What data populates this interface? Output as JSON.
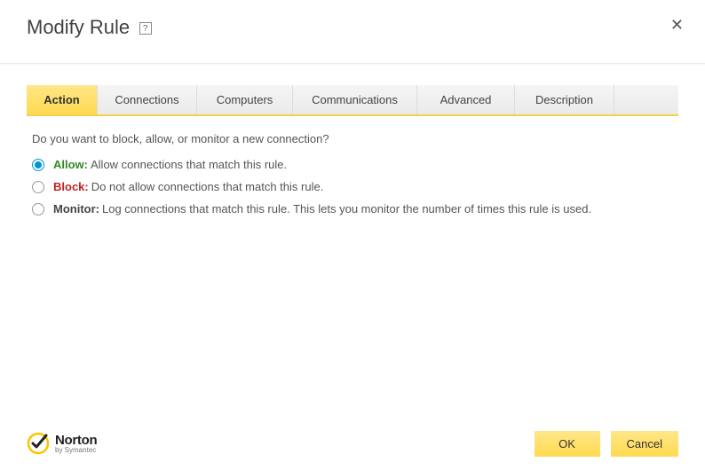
{
  "header": {
    "title": "Modify Rule",
    "help_glyph": "?",
    "close_glyph": "✕"
  },
  "tabs": [
    {
      "label": "Action",
      "active": true
    },
    {
      "label": "Connections",
      "active": false
    },
    {
      "label": "Computers",
      "active": false
    },
    {
      "label": "Communications",
      "active": false
    },
    {
      "label": "Advanced",
      "active": false
    },
    {
      "label": "Description",
      "active": false
    }
  ],
  "panel": {
    "prompt": "Do you want to block, allow, or monitor a new connection?",
    "options": [
      {
        "key": "allow",
        "label": "Allow:",
        "desc": "Allow connections that match this rule.",
        "selected": true
      },
      {
        "key": "block",
        "label": "Block:",
        "desc": "Do not allow connections that match this rule.",
        "selected": false
      },
      {
        "key": "monitor",
        "label": "Monitor:",
        "desc": "Log connections that match this rule. This lets you monitor the number of times this rule is used.",
        "selected": false
      }
    ]
  },
  "brand": {
    "name": "Norton",
    "sub": "by Symantec"
  },
  "buttons": {
    "ok": "OK",
    "cancel": "Cancel"
  }
}
